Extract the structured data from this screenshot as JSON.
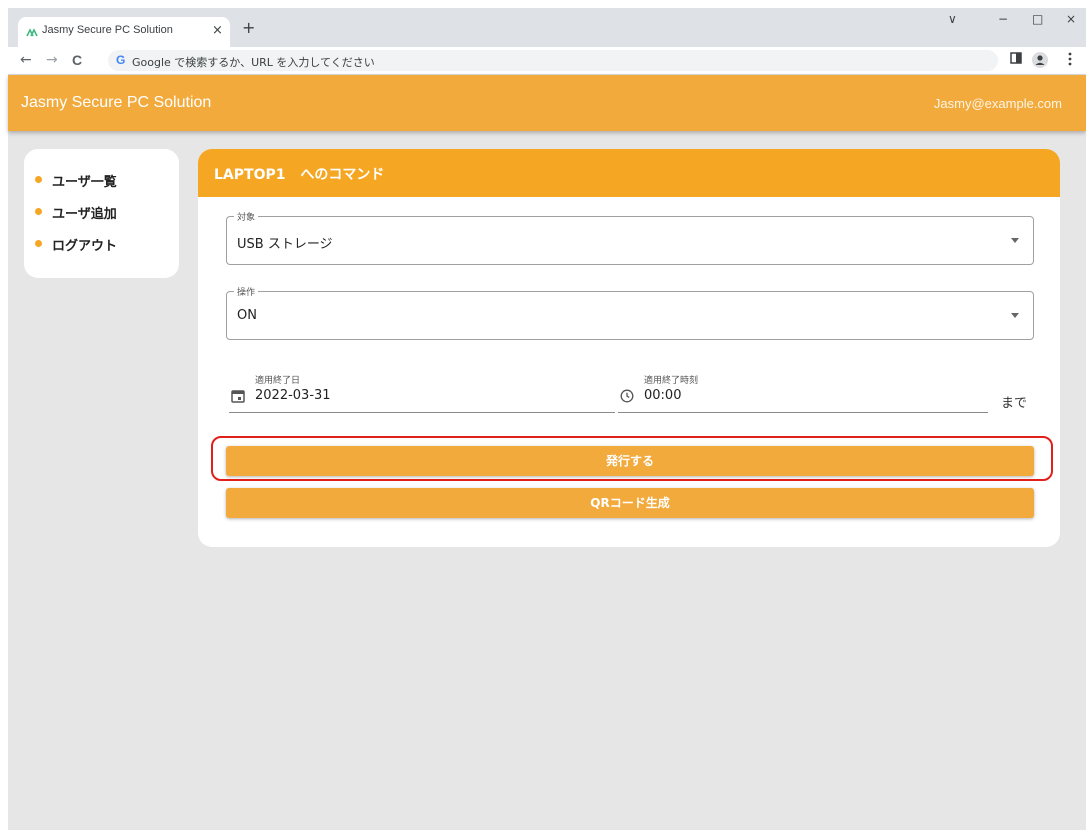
{
  "browser": {
    "tab_title": "Jasmy Secure PC Solution",
    "tab_close": "×",
    "new_tab": "+",
    "address_placeholder": "Google で検索するか、URL を入力してください",
    "google_g": "G",
    "window_controls": [
      "∨",
      "−",
      "□",
      "×"
    ],
    "nav": {
      "back": "←",
      "forward": "→",
      "reload": "C"
    }
  },
  "app": {
    "title": "Jasmy Secure PC Solution",
    "user_email": "Jasmy@example.com"
  },
  "sidebar": {
    "items": [
      {
        "label": "ユーザ一覧"
      },
      {
        "label": "ユーザ追加"
      },
      {
        "label": "ログアウト"
      }
    ]
  },
  "card": {
    "title": "LAPTOP1 へのコマンド",
    "target": {
      "legend": "対象",
      "value": "USB ストレージ"
    },
    "operation": {
      "legend": "操作",
      "value": "ON"
    },
    "end_date": {
      "label": "適用終了日",
      "value": "2022-03-31"
    },
    "end_time": {
      "label": "適用終了時刻",
      "value": "00:00"
    },
    "until_label": "まで",
    "issue_button": "発行する",
    "qr_button": "QRコード生成"
  },
  "colors": {
    "appbar": "#f2aa3c",
    "card_header": "#f5a623",
    "highlight": "#e0201b"
  }
}
